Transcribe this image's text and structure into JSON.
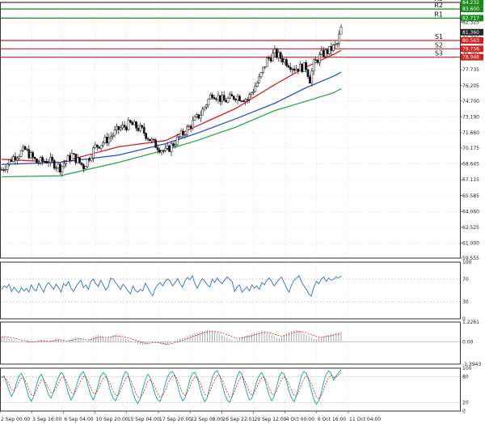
{
  "chart_data": {
    "type": "candlestick",
    "x_ticks": [
      "2 Sep 00:00",
      "3 Sep 16:00",
      "6 Sep 04:00",
      "10 Sep 20:00",
      "15 Sep 04:00",
      "17 Sep 20:00",
      "22 Sep 08:00",
      "26 Sep 22:01",
      "29 Sep 12:00",
      "4 Oct 00:00",
      "6 Oct 16:00",
      "11 Oct 04:00"
    ],
    "price_axis": {
      "ylim": [
        59.555,
        84.232
      ],
      "ticks": [
        "82.325",
        "80.795",
        "79.260",
        "77.735",
        "76.205",
        "74.700",
        "73.190",
        "71.660",
        "70.175",
        "68.645",
        "67.115",
        "65.585",
        "64.060",
        "62.525",
        "61.000",
        "59.555"
      ]
    },
    "levels": [
      {
        "name": "R3",
        "value": 84.232,
        "tag": "84.232",
        "color": "#1a8a1a"
      },
      {
        "name": "R2",
        "value": 83.6,
        "tag": "83.600",
        "color": "#1a8a1a"
      },
      {
        "name": "R1",
        "value": 82.717,
        "tag": "82.717",
        "color": "#1a8a1a"
      },
      {
        "name": "S1",
        "value": 80.563,
        "tag": "80.563",
        "color": "#d42020"
      },
      {
        "name": "S2",
        "value": 79.756,
        "tag": "79.756",
        "color": "#d42020"
      },
      {
        "name": "S3",
        "value": 78.948,
        "tag": "78.948",
        "color": "#d42020"
      }
    ],
    "current_price": {
      "value": 81.36,
      "tag": "81.360",
      "color": "#222222"
    },
    "candles": {
      "count": 138,
      "anchors": [
        [
          0,
          68.1
        ],
        [
          6,
          69.3
        ],
        [
          12,
          70.0
        ],
        [
          18,
          68.8
        ],
        [
          24,
          69.0
        ],
        [
          30,
          68.3
        ],
        [
          36,
          69.5
        ],
        [
          42,
          68.4
        ],
        [
          48,
          70.3
        ],
        [
          54,
          71.0
        ],
        [
          60,
          72.0
        ],
        [
          66,
          72.5
        ],
        [
          72,
          71.9
        ],
        [
          78,
          70.6
        ],
        [
          84,
          69.8
        ],
        [
          90,
          71.0
        ],
        [
          96,
          72.2
        ],
        [
          102,
          73.5
        ],
        [
          108,
          75.5
        ],
        [
          114,
          74.7
        ],
        [
          120,
          75.2
        ],
        [
          126,
          74.9
        ],
        [
          132,
          76.8
        ],
        [
          136,
          78.7
        ],
        [
          140,
          79.3
        ],
        [
          146,
          78.5
        ],
        [
          150,
          77.9
        ],
        [
          156,
          78.0
        ],
        [
          158,
          76.8
        ],
        [
          160,
          78.3
        ],
        [
          164,
          79.2
        ],
        [
          168,
          79.6
        ],
        [
          172,
          80.2
        ],
        [
          174,
          81.7
        ]
      ],
      "colors": {
        "bull": "#ffffff",
        "bear": "#111111",
        "wick": "#111111"
      }
    },
    "moving_averages": [
      {
        "color": "#d42020",
        "points": [
          [
            0,
            69.1
          ],
          [
            30,
            68.8
          ],
          [
            60,
            70.3
          ],
          [
            84,
            70.9
          ],
          [
            100,
            72.3
          ],
          [
            120,
            74.0
          ],
          [
            140,
            76.3
          ],
          [
            156,
            78.0
          ],
          [
            170,
            79.2
          ],
          [
            174,
            79.6
          ]
        ]
      },
      {
        "color": "#2c4fd1",
        "points": [
          [
            0,
            68.6
          ],
          [
            30,
            68.8
          ],
          [
            60,
            69.5
          ],
          [
            84,
            70.6
          ],
          [
            100,
            71.6
          ],
          [
            120,
            73.0
          ],
          [
            140,
            74.5
          ],
          [
            156,
            76.0
          ],
          [
            170,
            77.1
          ],
          [
            174,
            77.5
          ]
        ]
      },
      {
        "color": "#2ea84a",
        "points": [
          [
            0,
            67.4
          ],
          [
            30,
            67.5
          ],
          [
            60,
            68.8
          ],
          [
            84,
            70.0
          ],
          [
            100,
            70.9
          ],
          [
            120,
            72.2
          ],
          [
            140,
            73.8
          ],
          [
            156,
            74.7
          ],
          [
            170,
            75.5
          ],
          [
            174,
            75.9
          ]
        ]
      }
    ],
    "rsi": {
      "ticks": [
        "100",
        "70",
        "30",
        "0"
      ],
      "levels": [
        70,
        30
      ],
      "color": "#2c6fd1",
      "values": [
        52,
        58,
        55,
        61,
        48,
        56,
        50,
        46,
        55,
        49,
        54,
        47,
        60,
        52,
        49,
        63,
        54,
        47,
        59,
        64,
        58,
        52,
        61,
        55,
        47,
        62,
        58,
        66,
        54,
        48,
        57,
        63,
        68,
        55,
        60,
        52,
        66,
        70,
        62,
        57,
        68,
        60,
        51,
        56,
        72,
        70,
        64,
        58,
        52,
        61,
        56,
        49,
        44,
        58,
        50,
        47,
        52,
        49,
        63,
        55,
        46,
        41,
        54,
        60,
        64,
        58,
        66,
        70,
        67,
        58,
        64,
        71,
        62,
        56,
        67,
        73,
        69,
        76,
        62,
        54,
        64,
        71,
        66,
        60,
        56,
        70,
        64,
        72,
        66,
        62,
        68,
        74,
        70,
        66,
        48,
        56,
        60,
        47,
        52,
        56,
        49,
        60,
        54,
        58,
        52,
        64,
        60,
        68,
        72,
        66,
        58,
        64,
        70,
        74,
        64,
        54,
        47,
        60,
        68,
        72,
        76,
        66,
        58,
        52,
        44,
        40,
        56,
        66,
        62,
        70,
        74,
        66,
        72,
        68,
        70,
        74,
        72,
        76
      ]
    },
    "macd": {
      "ticks": [
        "1.2261",
        "0.00",
        "-1.3943"
      ],
      "range": [
        -1.3943,
        1.2261
      ],
      "hist_color": "#888888",
      "signal_color": "#d42020",
      "values": [
        0.3,
        0.35,
        0.28,
        0.22,
        0.18,
        0.1,
        0.05,
        -0.02,
        0.06,
        0.02,
        -0.05,
        -0.1,
        -0.06,
        -0.02,
        0.04,
        0.1,
        0.12,
        0.08,
        0.02,
        -0.03,
        0.05,
        0.12,
        0.2,
        0.18,
        0.1,
        0.04,
        -0.02,
        0.05,
        0.14,
        0.22,
        0.3,
        0.26,
        0.18,
        0.08,
        0.02,
        0.1,
        0.2,
        0.32,
        0.38,
        0.4,
        0.35,
        0.28,
        0.22,
        0.28,
        0.34,
        0.42,
        0.45,
        0.38,
        0.3,
        0.24,
        0.18,
        0.12,
        0.08,
        0.02,
        -0.06,
        -0.12,
        -0.18,
        -0.22,
        -0.2,
        -0.12,
        -0.05,
        0.02,
        0.0,
        -0.08,
        -0.14,
        -0.2,
        -0.24,
        -0.18,
        -0.1,
        0.0,
        0.08,
        0.14,
        0.2,
        0.24,
        0.3,
        0.36,
        0.42,
        0.48,
        0.55,
        0.6,
        0.62,
        0.66,
        0.7,
        0.74,
        0.7,
        0.66,
        0.62,
        0.58,
        0.5,
        0.42,
        0.34,
        0.26,
        0.2,
        0.14,
        0.08,
        0.12,
        0.2,
        0.3,
        0.36,
        0.4,
        0.44,
        0.5,
        0.56,
        0.6,
        0.64,
        0.7,
        0.66,
        0.58,
        0.5,
        0.42,
        0.34,
        0.26,
        0.2,
        0.3,
        0.42,
        0.54,
        0.62,
        0.68,
        0.72,
        0.74,
        0.7,
        0.62,
        0.52,
        0.42,
        0.34,
        0.26,
        0.2,
        0.18,
        0.22,
        0.28,
        0.34,
        0.38,
        0.42,
        0.46,
        0.5,
        0.55,
        0.58,
        0.6
      ]
    },
    "stochastic": {
      "ticks": [
        "100",
        "80",
        "20",
        "0"
      ],
      "levels": [
        80,
        20
      ],
      "main_color": "#1aa0a0",
      "signal_color": "#d42020",
      "values": [
        78,
        82,
        66,
        48,
        34,
        46,
        66,
        82,
        88,
        74,
        52,
        32,
        22,
        36,
        58,
        78,
        86,
        72,
        54,
        38,
        30,
        46,
        64,
        80,
        90,
        84,
        62,
        40,
        26,
        36,
        56,
        74,
        86,
        92,
        78,
        56,
        36,
        26,
        40,
        62,
        82,
        90,
        84,
        66,
        44,
        30,
        24,
        38,
        60,
        80,
        92,
        86,
        64,
        42,
        26,
        18,
        30,
        52,
        72,
        86,
        78,
        58,
        38,
        26,
        22,
        40,
        62,
        80,
        90,
        92,
        82,
        60,
        38,
        24,
        30,
        52,
        74,
        88,
        90,
        76,
        54,
        34,
        22,
        32,
        56,
        78,
        90,
        94,
        82,
        62,
        40,
        26,
        20,
        34,
        58,
        80,
        92,
        86,
        64,
        42,
        26,
        30,
        50,
        70,
        84,
        90,
        78,
        56,
        36,
        24,
        34,
        58,
        80,
        90,
        86,
        68,
        46,
        30,
        22,
        36,
        60,
        82,
        92,
        88,
        70,
        48,
        28,
        16,
        24,
        44,
        68,
        86,
        94,
        88,
        72,
        82,
        90,
        96
      ]
    }
  }
}
